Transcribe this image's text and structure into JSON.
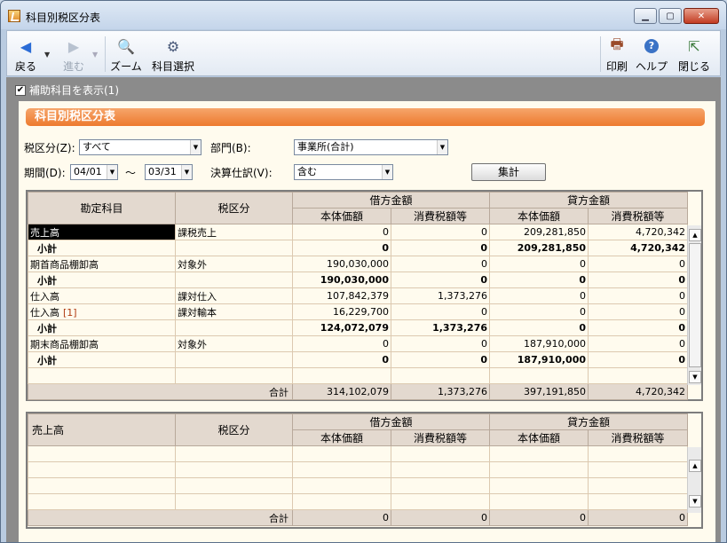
{
  "window": {
    "title": "科目別税区分表"
  },
  "toolbar": {
    "back": "戻る",
    "forward": "進む",
    "zoom": "ズーム",
    "select_account": "科目選択",
    "print": "印刷",
    "help": "ヘルプ",
    "close": "閉じる"
  },
  "options": {
    "show_sub_accounts": "補助科目を表示(1)"
  },
  "section": {
    "title": "科目別税区分表"
  },
  "filters": {
    "tax_label": "税区分(Z):",
    "tax_value": "すべて",
    "dept_label": "部門(B):",
    "dept_value": "事業所(合計)",
    "period_label": "期間(D):",
    "period_from": "04/01",
    "period_sep": "～",
    "period_to": "03/31",
    "closing_label": "決算仕訳(V):",
    "closing_value": "含む",
    "aggregate_button": "集計"
  },
  "table1": {
    "headers": {
      "account": "勘定科目",
      "tax": "税区分",
      "debit": "借方金額",
      "credit": "貸方金額",
      "base": "本体価額",
      "tax_amount": "消費税額等"
    },
    "rows": [
      {
        "account": "売上高",
        "tax": "課税売上",
        "d_base": "0",
        "d_tax": "0",
        "c_base": "209,281,850",
        "c_tax": "4,720,342"
      },
      {
        "account": "小計",
        "tax": "",
        "d_base": "0",
        "d_tax": "0",
        "c_base": "209,281,850",
        "c_tax": "4,720,342"
      },
      {
        "account": "期首商品棚卸高",
        "tax": "対象外",
        "d_base": "190,030,000",
        "d_tax": "0",
        "c_base": "0",
        "c_tax": "0"
      },
      {
        "account": "小計",
        "tax": "",
        "d_base": "190,030,000",
        "d_tax": "0",
        "c_base": "0",
        "c_tax": "0"
      },
      {
        "account": "仕入高",
        "tax": "課対仕入",
        "d_base": "107,842,379",
        "d_tax": "1,373,276",
        "c_base": "0",
        "c_tax": "0"
      },
      {
        "account": "仕入高",
        "account_suffix": "[1]",
        "tax": "課対輸本",
        "d_base": "16,229,700",
        "d_tax": "0",
        "c_base": "0",
        "c_tax": "0"
      },
      {
        "account": "小計",
        "tax": "",
        "d_base": "124,072,079",
        "d_tax": "1,373,276",
        "c_base": "0",
        "c_tax": "0"
      },
      {
        "account": "期末商品棚卸高",
        "tax": "対象外",
        "d_base": "0",
        "d_tax": "0",
        "c_base": "187,910,000",
        "c_tax": "0"
      },
      {
        "account": "小計",
        "tax": "",
        "d_base": "0",
        "d_tax": "0",
        "c_base": "187,910,000",
        "c_tax": "0"
      }
    ],
    "total": {
      "label": "合計",
      "d_base": "314,102,079",
      "d_tax": "1,373,276",
      "c_base": "397,191,850",
      "c_tax": "4,720,342"
    }
  },
  "table2": {
    "headers": {
      "account": "売上高",
      "tax": "税区分",
      "debit": "借方金額",
      "credit": "貸方金額",
      "base": "本体価額",
      "tax_amount": "消費税額等"
    },
    "total": {
      "label": "合計",
      "d_base": "0",
      "d_tax": "0",
      "c_base": "0",
      "c_tax": "0"
    }
  },
  "colors": {
    "accent": "#ed7a2e",
    "panel": "#8b8b8b",
    "content_bg": "#fffbee",
    "header_bg": "#e3d9cf",
    "suffix": "#b03a10"
  }
}
